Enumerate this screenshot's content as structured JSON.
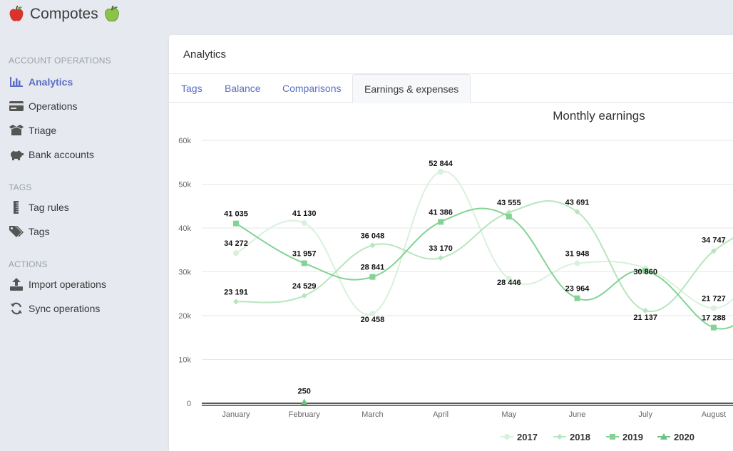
{
  "app": {
    "title": "Compotes"
  },
  "sidebar": {
    "sections": [
      {
        "title": "ACCOUNT OPERATIONS",
        "items": [
          {
            "label": "Analytics",
            "icon": "bar-chart-icon"
          },
          {
            "label": "Operations",
            "icon": "credit-card-icon"
          },
          {
            "label": "Triage",
            "icon": "box-icon"
          },
          {
            "label": "Bank accounts",
            "icon": "piggy-bank-icon"
          }
        ]
      },
      {
        "title": "TAGS",
        "items": [
          {
            "label": "Tag rules",
            "icon": "ruler-icon"
          },
          {
            "label": "Tags",
            "icon": "tags-icon"
          }
        ]
      },
      {
        "title": "ACTIONS",
        "items": [
          {
            "label": "Import operations",
            "icon": "upload-icon"
          },
          {
            "label": "Sync operations",
            "icon": "sync-icon"
          }
        ]
      }
    ],
    "active_item": "Analytics"
  },
  "panel": {
    "title": "Analytics",
    "tabs": [
      "Tags",
      "Balance",
      "Comparisons",
      "Earnings & expenses"
    ],
    "active_tab": "Earnings & expenses"
  },
  "colors": {
    "accent": "#5a6dc7",
    "s2017": "#d9f1dc",
    "s2018": "#b6e6bd",
    "s2019": "#84d394",
    "s2020": "#6cc27f"
  },
  "chart_data": {
    "type": "line",
    "title": "Monthly earnings",
    "categories": [
      "January",
      "February",
      "March",
      "April",
      "May",
      "June",
      "July",
      "August"
    ],
    "yticks": [
      "0",
      "10k",
      "20k",
      "30k",
      "40k",
      "50k",
      "60k"
    ],
    "ylim": [
      0,
      60000
    ],
    "grid": true,
    "legend_position": "bottom",
    "series": [
      {
        "name": "2017",
        "marker": "circle",
        "values": [
          34272,
          41130,
          20458,
          52844,
          28446,
          31948,
          30860,
          21727
        ],
        "labels": [
          "34 272",
          "41 130",
          "20 458",
          "52 844",
          "28 446",
          "31 948",
          "30 860",
          "21 727"
        ]
      },
      {
        "name": "2018",
        "marker": "diamond",
        "values": [
          23191,
          24529,
          36048,
          33170,
          43555,
          43691,
          21137,
          34747
        ],
        "labels": [
          "23 191",
          "24 529",
          "36 048",
          "33 170",
          "43 555",
          "43 691",
          "21 137",
          "34 747"
        ]
      },
      {
        "name": "2019",
        "marker": "square",
        "values": [
          41035,
          31957,
          28841,
          41386,
          42600,
          23964,
          30200,
          17288
        ],
        "labels": [
          "41 035",
          "31 957",
          "28 841",
          "41 386",
          "",
          "23 964",
          "",
          "17 288"
        ]
      },
      {
        "name": "2020",
        "marker": "triangle",
        "values": [
          null,
          250,
          null,
          null,
          null,
          null,
          null,
          null
        ],
        "labels": [
          "",
          "250",
          "",
          "",
          "",
          "",
          "",
          ""
        ]
      }
    ]
  }
}
